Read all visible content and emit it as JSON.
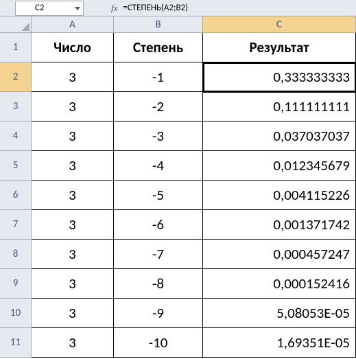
{
  "nameBox": "C2",
  "fxLabel": "fx",
  "formula": "=СТЕПЕНЬ(A2;B2)",
  "columns": [
    "A",
    "B",
    "C"
  ],
  "headers": {
    "a": "Число",
    "b": "Степень",
    "c": "Результат"
  },
  "activeCell": {
    "row": 2,
    "col": "C"
  },
  "rows": [
    {
      "n": 2,
      "a": "3",
      "b": "-1",
      "c": "0,333333333"
    },
    {
      "n": 3,
      "a": "3",
      "b": "-2",
      "c": "0,111111111"
    },
    {
      "n": 4,
      "a": "3",
      "b": "-3",
      "c": "0,037037037"
    },
    {
      "n": 5,
      "a": "3",
      "b": "-4",
      "c": "0,012345679"
    },
    {
      "n": 6,
      "a": "3",
      "b": "-5",
      "c": "0,004115226"
    },
    {
      "n": 7,
      "a": "3",
      "b": "-6",
      "c": "0,001371742"
    },
    {
      "n": 8,
      "a": "3",
      "b": "-7",
      "c": "0,000457247"
    },
    {
      "n": 9,
      "a": "3",
      "b": "-8",
      "c": "0,000152416"
    },
    {
      "n": 10,
      "a": "3",
      "b": "-9",
      "c": "5,08053E-05"
    },
    {
      "n": 11,
      "a": "3",
      "b": "-10",
      "c": "1,69351E-05"
    }
  ]
}
